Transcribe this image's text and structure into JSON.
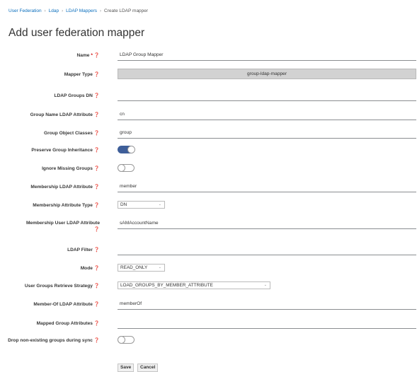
{
  "breadcrumb": {
    "items": [
      "User Federation",
      "Ldap",
      "LDAP Mappers"
    ],
    "separator": "›",
    "current": "Create LDAP mapper"
  },
  "page": {
    "title": "Add user federation mapper"
  },
  "help_icon": "question-circle-icon",
  "required_mark": "*",
  "form": {
    "name": {
      "label": "Name",
      "value": "LDAP Group Mapper"
    },
    "mapper_type": {
      "label": "Mapper Type",
      "value": "group-ldap-mapper"
    },
    "ldap_groups_dn": {
      "label": "LDAP Groups DN",
      "value": ""
    },
    "group_name_attr": {
      "label": "Group Name LDAP Attribute",
      "value": "cn"
    },
    "group_object_classes": {
      "label": "Group Object Classes",
      "value": "group"
    },
    "preserve_inheritance": {
      "label": "Preserve Group Inheritance",
      "on": true
    },
    "ignore_missing": {
      "label": "Ignore Missing Groups",
      "on": false
    },
    "membership_attr": {
      "label": "Membership LDAP Attribute",
      "value": "member"
    },
    "membership_attr_type": {
      "label": "Membership Attribute Type",
      "value": "DN"
    },
    "membership_user_attr": {
      "label": "Membership User LDAP Attribute",
      "value": "sAMAccountName"
    },
    "ldap_filter": {
      "label": "LDAP Filter",
      "value": ""
    },
    "mode": {
      "label": "Mode",
      "value": "READ_ONLY"
    },
    "retrieve_strategy": {
      "label": "User Groups Retrieve Strategy",
      "value": "LOAD_GROUPS_BY_MEMBER_ATTRIBUTE"
    },
    "member_of_attr": {
      "label": "Member-Of LDAP Attribute",
      "value": "memberOf"
    },
    "mapped_group_attrs": {
      "label": "Mapped Group Attributes",
      "value": ""
    },
    "drop_nonexisting": {
      "label": "Drop non-existing groups during sync",
      "on": false
    }
  },
  "buttons": {
    "save": "Save",
    "cancel": "Cancel"
  },
  "colors": {
    "link": "#0a6ebd",
    "toggle_on": "#3e5e99",
    "required": "#cc0000"
  }
}
